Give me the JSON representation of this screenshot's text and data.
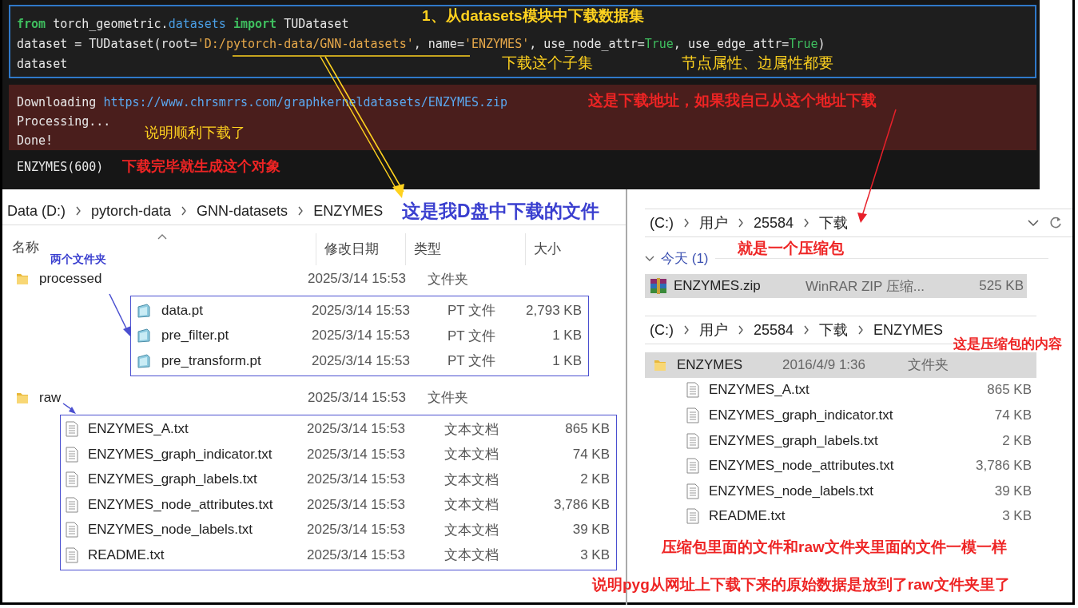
{
  "code_cell": {
    "lines": [
      [
        {
          "kind": "keyword",
          "text": "from"
        },
        {
          "kind": "plain",
          "text": " torch_geometric."
        },
        {
          "kind": "module",
          "text": "datasets"
        },
        {
          "kind": "keyword",
          "text": " import"
        },
        {
          "kind": "plain",
          "text": " TUDataset"
        }
      ],
      [
        {
          "kind": "plain",
          "text": "dataset = TUDataset(root="
        },
        {
          "kind": "string",
          "text": "'D:/pytorch-data/GNN-datasets'"
        },
        {
          "kind": "plain",
          "text": ", name="
        },
        {
          "kind": "string",
          "text": "'ENZYMES'"
        },
        {
          "kind": "plain",
          "text": ", use_node_attr="
        },
        {
          "kind": "constant",
          "text": "True"
        },
        {
          "kind": "plain",
          "text": ", use_edge_attr="
        },
        {
          "kind": "constant",
          "text": "True"
        },
        {
          "kind": "plain",
          "text": ")"
        }
      ],
      [
        {
          "kind": "plain",
          "text": "dataset"
        }
      ]
    ],
    "stderr": [
      {
        "text": "Downloading",
        "link": "https://www.chrsmrrs.com/graphkerneldatasets/ENZYMES.zip"
      },
      {
        "text": "Processing..."
      },
      {
        "text": "Done!"
      }
    ],
    "result": "ENZYMES(600)"
  },
  "left_explorer": {
    "breadcrumb": [
      "Data (D:)",
      "pytorch-data",
      "GNN-datasets",
      "ENZYMES"
    ],
    "columns": [
      "名称",
      "修改日期",
      "类型",
      "大小"
    ],
    "items": [
      {
        "name": "processed",
        "kind": "folder",
        "modified": "2025/3/14 15:53",
        "type": "文件夹",
        "children": [
          {
            "name": "data.pt",
            "kind": "pt",
            "modified": "2025/3/14 15:53",
            "type": "PT 文件",
            "size": "2,793 KB"
          },
          {
            "name": "pre_filter.pt",
            "kind": "pt",
            "modified": "2025/3/14 15:53",
            "type": "PT 文件",
            "size": "1 KB"
          },
          {
            "name": "pre_transform.pt",
            "kind": "pt",
            "modified": "2025/3/14 15:53",
            "type": "PT 文件",
            "size": "1 KB"
          }
        ]
      },
      {
        "name": "raw",
        "kind": "folder",
        "modified": "2025/3/14 15:53",
        "type": "文件夹",
        "children": [
          {
            "name": "ENZYMES_A.txt",
            "kind": "txt",
            "modified": "2025/3/14 15:53",
            "type": "文本文档",
            "size": "865 KB"
          },
          {
            "name": "ENZYMES_graph_indicator.txt",
            "kind": "txt",
            "modified": "2025/3/14 15:53",
            "type": "文本文档",
            "size": "74 KB"
          },
          {
            "name": "ENZYMES_graph_labels.txt",
            "kind": "txt",
            "modified": "2025/3/14 15:53",
            "type": "文本文档",
            "size": "2 KB"
          },
          {
            "name": "ENZYMES_node_attributes.txt",
            "kind": "txt",
            "modified": "2025/3/14 15:53",
            "type": "文本文档",
            "size": "3,786 KB"
          },
          {
            "name": "ENZYMES_node_labels.txt",
            "kind": "txt",
            "modified": "2025/3/14 15:53",
            "type": "文本文档",
            "size": "39 KB"
          },
          {
            "name": "README.txt",
            "kind": "txt",
            "modified": "2025/3/14 15:53",
            "type": "文本文档",
            "size": "3 KB"
          }
        ]
      }
    ]
  },
  "downloads_explorer": {
    "breadcrumb": [
      "(C:)",
      "用户",
      "25584",
      "下载"
    ],
    "group": {
      "label": "今天 (1)",
      "expanded": true
    },
    "items": [
      {
        "name": "ENZYMES.zip",
        "kind": "zip",
        "type": "WinRAR ZIP 压缩...",
        "size": "525 KB",
        "selected": true
      }
    ]
  },
  "archive_explorer": {
    "breadcrumb": [
      "(C:)",
      "用户",
      "25584",
      "下载",
      "ENZYMES"
    ],
    "items": [
      {
        "name": "ENZYMES",
        "kind": "folder",
        "modified": "2016/4/9 1:36",
        "type": "文件夹",
        "selected": true,
        "children": [
          {
            "name": "ENZYMES_A.txt",
            "kind": "txt",
            "size": "865 KB",
            "selected": false
          },
          {
            "name": "ENZYMES_graph_indicator.txt",
            "kind": "txt",
            "size": "74 KB",
            "selected": false
          },
          {
            "name": "ENZYMES_graph_labels.txt",
            "kind": "txt",
            "size": "2 KB",
            "selected": false
          },
          {
            "name": "ENZYMES_node_attributes.txt",
            "kind": "txt",
            "size": "3,786 KB",
            "selected": false
          },
          {
            "name": "ENZYMES_node_labels.txt",
            "kind": "txt",
            "size": "39 KB",
            "selected": false
          },
          {
            "name": "README.txt",
            "kind": "txt",
            "size": "3 KB",
            "selected": false
          }
        ]
      }
    ]
  },
  "annotations": [
    {
      "text": "1、从datasets模块中下载数据集",
      "color": "#ffd21f"
    },
    {
      "text": "下载这个子集",
      "color": "#ffd21f"
    },
    {
      "text": "节点属性、边属性都要",
      "color": "#ffd21f"
    },
    {
      "text": "这是下载地址，如果我自己从这个地址下载",
      "color": "#ee2424"
    },
    {
      "text": "说明顺利下载了",
      "color": "#ffd21f"
    },
    {
      "text": "下载完毕就生成这个对象",
      "color": "#ee2424"
    },
    {
      "text": "这是我D盘中下载的文件",
      "color": "#3a3fcf"
    },
    {
      "text": "两个文件夹",
      "color": "#3a3fcf"
    },
    {
      "text": "就是一个压缩包",
      "color": "#ee2424"
    },
    {
      "text": "这是压缩包的内容",
      "color": "#ee2424"
    },
    {
      "text": "压缩包里面的文件和raw文件夹里面的文件一模一样",
      "color": "#ee2424"
    },
    {
      "text": "说明pyg从网址上下载下来的原始数据是放到了raw文件夹里了",
      "color": "#ee2424"
    }
  ]
}
